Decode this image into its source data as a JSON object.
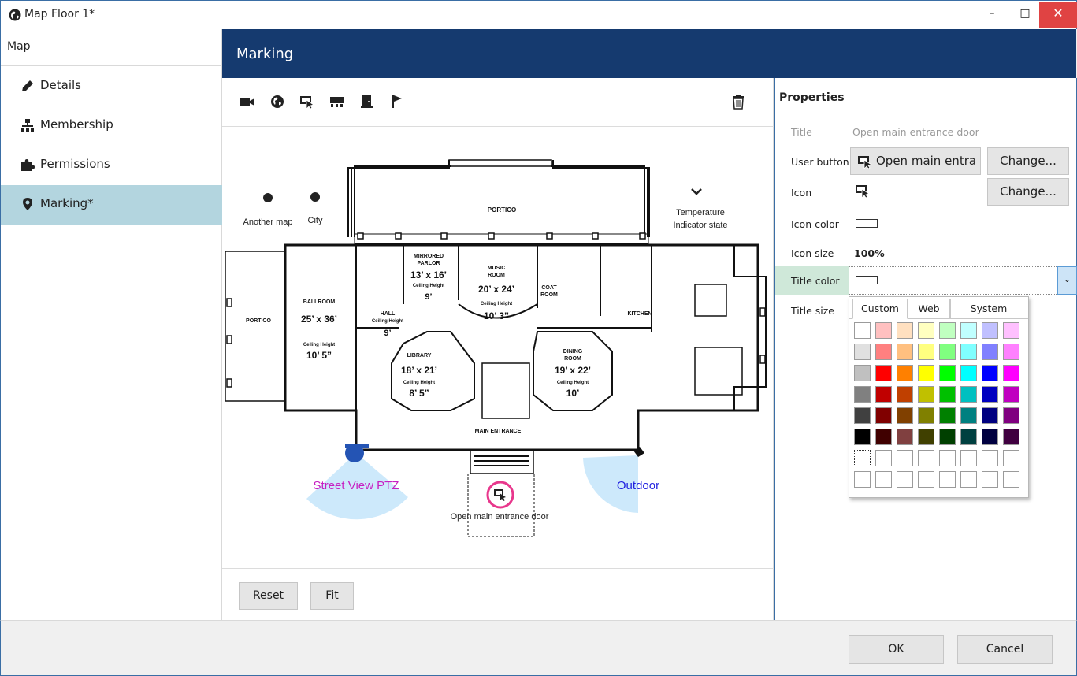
{
  "window": {
    "title": "Map Floor 1*",
    "min_glyph": "–",
    "max_glyph": "□",
    "close_glyph": "✕"
  },
  "sidebar": {
    "header": "Map",
    "items": [
      {
        "label": "Details",
        "icon": "pencil-icon"
      },
      {
        "label": "Membership",
        "icon": "membership-icon"
      },
      {
        "label": "Permissions",
        "icon": "puzzle-icon"
      },
      {
        "label": "Marking*",
        "icon": "map-marker-icon",
        "active": true
      }
    ]
  },
  "marking": {
    "title": "Marking",
    "tools": [
      "camera-icon",
      "globe-icon",
      "user-button-icon",
      "sensor-icon",
      "door-icon",
      "flag-icon"
    ],
    "delete_icon": "trash-icon",
    "map_items": {
      "another_map": "Another map",
      "city": "City",
      "temperature": "Temperature",
      "indicator_state": "Indicator state",
      "street_view": "Street View PTZ",
      "outdoor": "Outdoor",
      "main_door": "Open main entrance door"
    },
    "floorplan": {
      "portico_top": "PORTICO",
      "portico_left": "PORTICO",
      "mirrored": "MIRRORED",
      "parlor": "PARLOR",
      "parlor_size": "13’ x 16’",
      "ceiling_height": "Ceiling Height",
      "parlor_ch": "9’",
      "music": "MUSIC",
      "room": "ROOM",
      "music_size": "20’ x 24’",
      "music_ch": "10’ 3”",
      "coat": "COAT",
      "kitchen": "KITCHEN",
      "ballroom": "BALLROOM",
      "ballroom_size": "25’ x 36’",
      "ballroom_ch": "10’ 5”",
      "hall": "HALL",
      "hall_ch": "9’",
      "library": "LIBRARY",
      "library_size": "18’ x 21’",
      "library_ch": "8’ 5”",
      "dining": "DINING",
      "dining_size": "19’ x 22’",
      "dining_ch": "10’",
      "main_entrance": "MAIN ENTRANCE"
    },
    "reset": "Reset",
    "fit": "Fit"
  },
  "properties": {
    "heading": "Properties",
    "title_label": "Title",
    "title_value": "Open main entrance door",
    "user_button_label": "User button",
    "user_button_value": "Open main entra",
    "change": "Change...",
    "icon_label": "Icon",
    "icon_color_label": "Icon color",
    "icon_size_label": "Icon size",
    "icon_size_value": "100%",
    "title_color_label": "Title color",
    "title_size_label": "Title size"
  },
  "color_picker": {
    "tabs": [
      "Custom",
      "Web",
      "System"
    ],
    "active_tab": "Custom",
    "rows": [
      [
        "#ffffff",
        "#ffc0c0",
        "#ffe0c0",
        "#ffffc0",
        "#c0ffc0",
        "#c0ffff",
        "#c0c0ff",
        "#ffc0ff"
      ],
      [
        "#e0e0e0",
        "#ff8080",
        "#ffc080",
        "#ffff80",
        "#80ff80",
        "#80ffff",
        "#8080ff",
        "#ff80ff"
      ],
      [
        "#c0c0c0",
        "#ff0000",
        "#ff8000",
        "#ffff00",
        "#00ff00",
        "#00ffff",
        "#0000ff",
        "#ff00ff"
      ],
      [
        "#808080",
        "#c00000",
        "#c04000",
        "#c0c000",
        "#00c000",
        "#00c0c0",
        "#0000c0",
        "#c000c0"
      ],
      [
        "#404040",
        "#800000",
        "#804000",
        "#808000",
        "#008000",
        "#008080",
        "#000080",
        "#800080"
      ],
      [
        "#000000",
        "#400000",
        "#804040",
        "#404000",
        "#004000",
        "#004040",
        "#000040",
        "#400040"
      ],
      [
        "#ffffff",
        "#ffffff",
        "#ffffff",
        "#ffffff",
        "#ffffff",
        "#ffffff",
        "#ffffff",
        "#ffffff"
      ],
      [
        "#ffffff",
        "#ffffff",
        "#ffffff",
        "#ffffff",
        "#ffffff",
        "#ffffff",
        "#ffffff",
        "#ffffff"
      ]
    ]
  },
  "footer": {
    "ok": "OK",
    "cancel": "Cancel"
  },
  "colors": {
    "header_bg": "#153a6f",
    "active_item": "#b3d5df",
    "close_red": "#e04343",
    "ptz_label": "#c71fc2",
    "outdoor_label": "#1f1fe0",
    "fov": "#cde9fb",
    "highlight_ring": "#e8378c"
  }
}
